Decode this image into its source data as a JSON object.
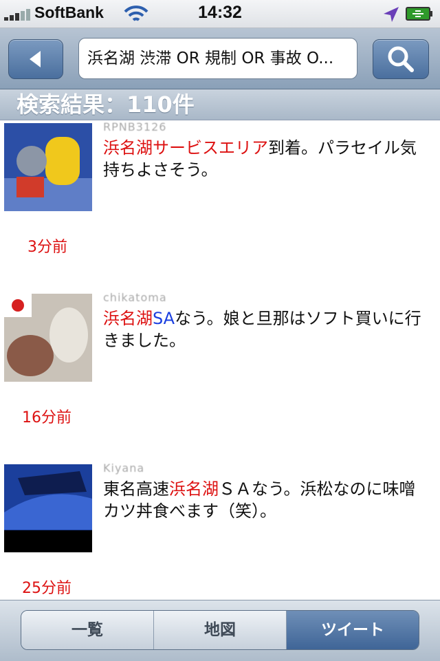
{
  "status_bar": {
    "carrier": "SoftBank",
    "time": "14:32"
  },
  "nav": {
    "back_icon": "chevron-left-icon",
    "search_query": "浜名湖 渋滞 OR 規制 OR 事故 O...",
    "search_icon": "magnifier-icon"
  },
  "results": {
    "header": "検索結果：110件"
  },
  "tweets": [
    {
      "username": "RPNB3126",
      "segments": [
        {
          "text": "浜名湖サービスエリア",
          "style": "red"
        },
        {
          "text": "到着。パラセイル気持ちよさそう。",
          "style": "normal"
        }
      ],
      "time": "3分前"
    },
    {
      "username": "chikatoma",
      "segments": [
        {
          "text": "浜名湖",
          "style": "red"
        },
        {
          "text": "SA",
          "style": "blue"
        },
        {
          "text": "なう。娘と旦那はソフト買いに行きました。",
          "style": "normal"
        }
      ],
      "time": "16分前"
    },
    {
      "username": "Kiyana",
      "segments": [
        {
          "text": "東名高速",
          "style": "normal"
        },
        {
          "text": "浜名湖",
          "style": "red"
        },
        {
          "text": "ＳＡなう。浜松なのに味噌カツ丼食べます（笑）。",
          "style": "normal"
        }
      ],
      "time": "25分前"
    }
  ],
  "tabs": {
    "items": [
      "一覧",
      "地図",
      "ツイート"
    ],
    "active": "ツイート"
  },
  "colors": {
    "highlight_red": "#dd1111",
    "highlight_blue": "#1a3fe0",
    "nav_blue": "#4a6f9e"
  }
}
